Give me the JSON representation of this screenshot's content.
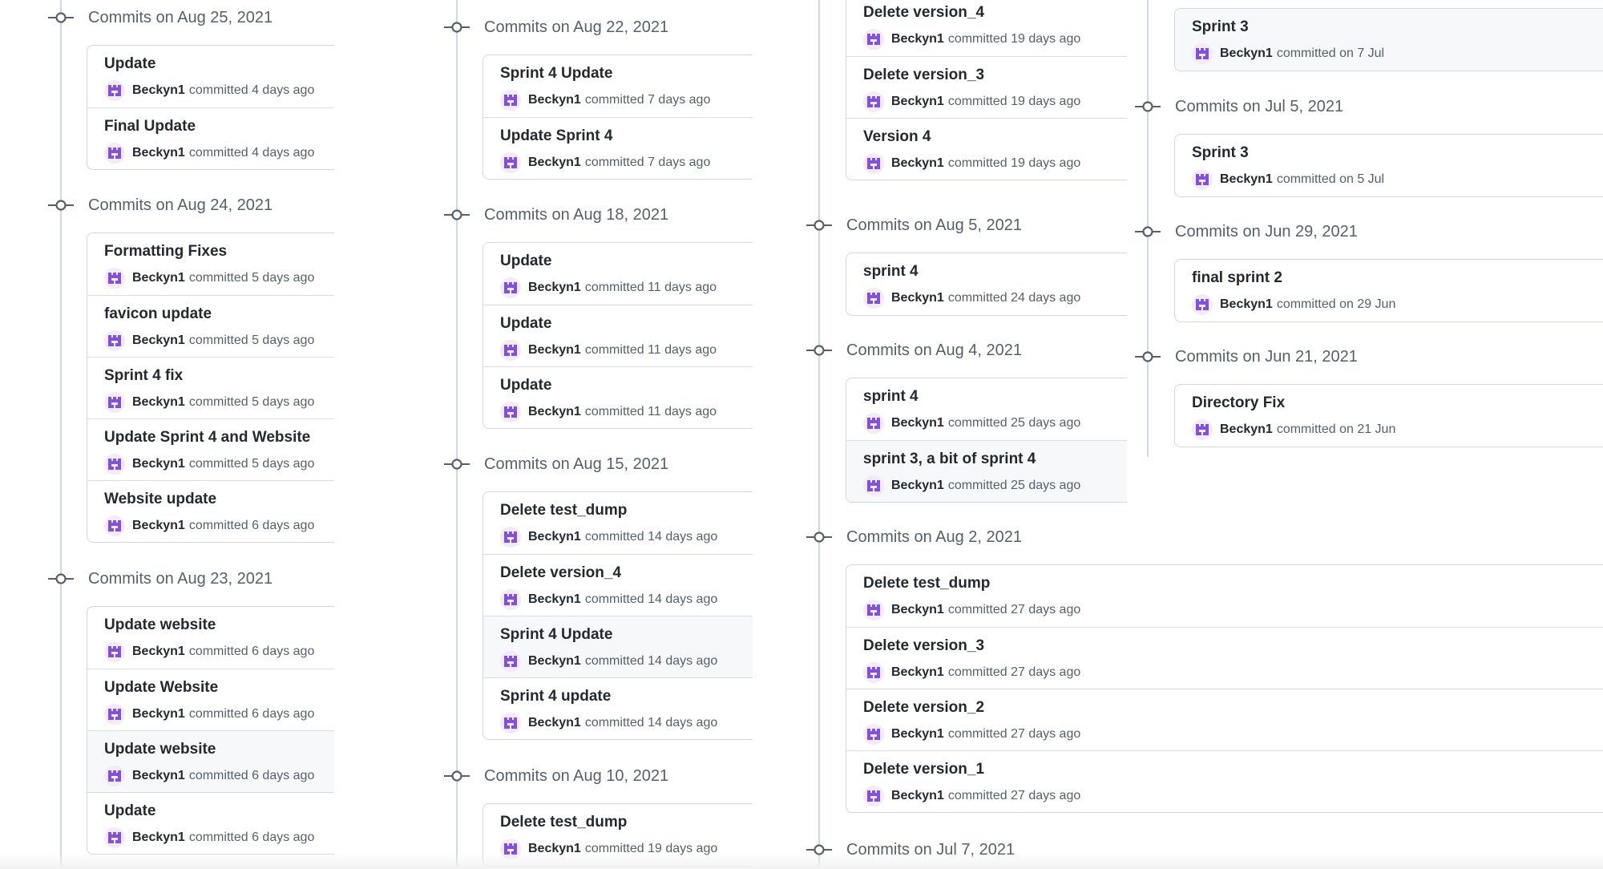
{
  "accent_color": "#8250df",
  "avatar_icon": "identicon-icon",
  "commit_node_icon": "git-commit-icon",
  "columns": [
    {
      "groups": [
        {
          "title": "Commits on Aug 25, 2021",
          "commits": [
            {
              "message": "Update",
              "author": "Beckyn1",
              "time": "committed 4 days ago",
              "highlighted": false
            },
            {
              "message": "Final Update",
              "author": "Beckyn1",
              "time": "committed 4 days ago",
              "highlighted": false
            }
          ]
        },
        {
          "title": "Commits on Aug 24, 2021",
          "commits": [
            {
              "message": "Formatting Fixes",
              "author": "Beckyn1",
              "time": "committed 5 days ago",
              "highlighted": false
            },
            {
              "message": "favicon update",
              "author": "Beckyn1",
              "time": "committed 5 days ago",
              "highlighted": false
            },
            {
              "message": "Sprint 4 fix",
              "author": "Beckyn1",
              "time": "committed 5 days ago",
              "highlighted": false
            },
            {
              "message": "Update Sprint 4 and Website",
              "author": "Beckyn1",
              "time": "committed 5 days ago",
              "highlighted": false
            },
            {
              "message": "Website update",
              "author": "Beckyn1",
              "time": "committed 6 days ago",
              "highlighted": false
            }
          ]
        },
        {
          "title": "Commits on Aug 23, 2021",
          "commits": [
            {
              "message": "Update website",
              "author": "Beckyn1",
              "time": "committed 6 days ago",
              "highlighted": false
            },
            {
              "message": "Update Website",
              "author": "Beckyn1",
              "time": "committed 6 days ago",
              "highlighted": false
            },
            {
              "message": "Update website",
              "author": "Beckyn1",
              "time": "committed 6 days ago",
              "highlighted": true
            },
            {
              "message": "Update",
              "author": "Beckyn1",
              "time": "committed 6 days ago",
              "highlighted": false
            }
          ]
        }
      ]
    },
    {
      "groups": [
        {
          "title": "Commits on Aug 22, 2021",
          "commits": [
            {
              "message": "Sprint 4 Update",
              "author": "Beckyn1",
              "time": "committed 7 days ago",
              "highlighted": false
            },
            {
              "message": "Update Sprint 4",
              "author": "Beckyn1",
              "time": "committed 7 days ago",
              "highlighted": false
            }
          ]
        },
        {
          "title": "Commits on Aug 18, 2021",
          "commits": [
            {
              "message": "Update",
              "author": "Beckyn1",
              "time": "committed 11 days ago",
              "highlighted": false
            },
            {
              "message": "Update",
              "author": "Beckyn1",
              "time": "committed 11 days ago",
              "highlighted": false
            },
            {
              "message": "Update",
              "author": "Beckyn1",
              "time": "committed 11 days ago",
              "highlighted": false
            }
          ]
        },
        {
          "title": "Commits on Aug 15, 2021",
          "commits": [
            {
              "message": "Delete test_dump",
              "author": "Beckyn1",
              "time": "committed 14 days ago",
              "highlighted": false
            },
            {
              "message": "Delete version_4",
              "author": "Beckyn1",
              "time": "committed 14 days ago",
              "highlighted": false
            },
            {
              "message": "Sprint 4 Update",
              "author": "Beckyn1",
              "time": "committed 14 days ago",
              "highlighted": true
            },
            {
              "message": "Sprint 4 update",
              "author": "Beckyn1",
              "time": "committed 14 days ago",
              "highlighted": false
            }
          ]
        },
        {
          "title": "Commits on Aug 10, 2021",
          "commits": [
            {
              "message": "Delete test_dump",
              "author": "Beckyn1",
              "time": "committed 19 days ago",
              "highlighted": false
            }
          ]
        }
      ]
    },
    {
      "groups": [
        {
          "title": "",
          "commits": [
            {
              "message": "Delete version_4",
              "author": "Beckyn1",
              "time": "committed 19 days ago",
              "highlighted": false
            },
            {
              "message": "Delete version_3",
              "author": "Beckyn1",
              "time": "committed 19 days ago",
              "highlighted": false
            },
            {
              "message": "Version 4",
              "author": "Beckyn1",
              "time": "committed 19 days ago",
              "highlighted": false
            }
          ]
        },
        {
          "title": "Commits on Aug 5, 2021",
          "commits": [
            {
              "message": "sprint 4",
              "author": "Beckyn1",
              "time": "committed 24 days ago",
              "highlighted": false
            }
          ]
        },
        {
          "title": "Commits on Aug 4, 2021",
          "commits": [
            {
              "message": "sprint 4",
              "author": "Beckyn1",
              "time": "committed 25 days ago",
              "highlighted": false
            },
            {
              "message": "sprint 3, a bit of sprint 4",
              "author": "Beckyn1",
              "time": "committed 25 days ago",
              "highlighted": true
            }
          ]
        },
        {
          "title": "Commits on Aug 2, 2021",
          "commits": [
            {
              "message": "Delete test_dump",
              "author": "Beckyn1",
              "time": "committed 27 days ago",
              "highlighted": false
            },
            {
              "message": "Delete version_3",
              "author": "Beckyn1",
              "time": "committed 27 days ago",
              "highlighted": false
            },
            {
              "message": "Delete version_2",
              "author": "Beckyn1",
              "time": "committed 27 days ago",
              "highlighted": false
            },
            {
              "message": "Delete version_1",
              "author": "Beckyn1",
              "time": "committed 27 days ago",
              "highlighted": false
            }
          ]
        },
        {
          "title": "Commits on Jul 7, 2021",
          "commits": []
        }
      ]
    },
    {
      "groups": [
        {
          "title": "",
          "commits": [
            {
              "message": "Sprint 3",
              "author": "Beckyn1",
              "time": "committed on 7 Jul",
              "highlighted": true
            }
          ]
        },
        {
          "title": "Commits on Jul 5, 2021",
          "commits": [
            {
              "message": "Sprint 3",
              "author": "Beckyn1",
              "time": "committed on 5 Jul",
              "highlighted": false
            }
          ]
        },
        {
          "title": "Commits on Jun 29, 2021",
          "commits": [
            {
              "message": "final sprint 2",
              "author": "Beckyn1",
              "time": "committed on 29 Jun",
              "highlighted": false
            }
          ]
        },
        {
          "title": "Commits on Jun 21, 2021",
          "commits": [
            {
              "message": "Directory Fix",
              "author": "Beckyn1",
              "time": "committed on 21 Jun",
              "highlighted": false
            }
          ]
        }
      ]
    }
  ]
}
